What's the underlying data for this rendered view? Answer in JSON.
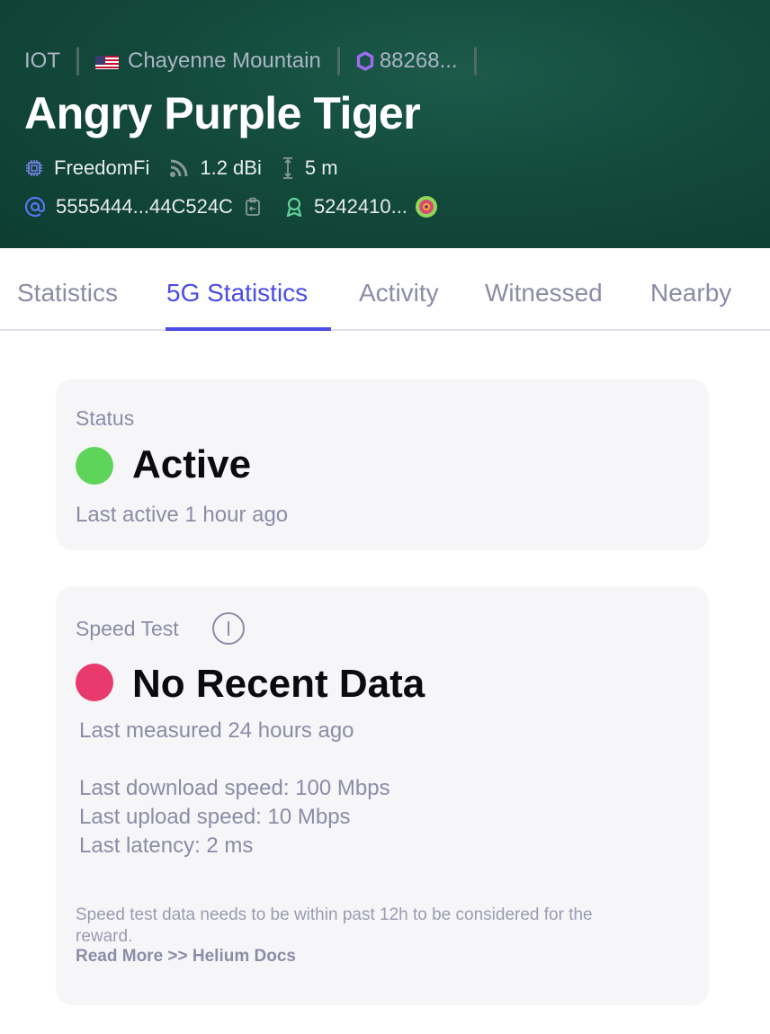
{
  "header": {
    "network": "IOT",
    "location": "Chayenne Mountain",
    "hex_id": "88268...",
    "title": "Angry Purple Tiger",
    "maker": "FreedomFi",
    "antenna_gain": "1.2 dBi",
    "elevation": "5 m",
    "address": "5555444...44C524C",
    "owner": "5242410..."
  },
  "icons": {
    "flag": "us-flag-icon",
    "hex": "hexagon-icon",
    "chip": "chip-icon",
    "signal": "signal-icon",
    "elevation": "elevation-icon",
    "address": "at-icon",
    "copy": "copy-icon",
    "owner": "user-badge-icon",
    "avatar": "avatar-icon",
    "info": "info-icon"
  },
  "tabs": [
    "Statistics",
    "5G Statistics",
    "Activity",
    "Witnessed",
    "Nearby"
  ],
  "active_tab": "5G Statistics",
  "status_card": {
    "label": "Status",
    "value": "Active",
    "detail": "Last active 1 hour ago",
    "color": "#5fd45a"
  },
  "speed_card": {
    "label": "Speed Test",
    "value": "No Recent Data",
    "measured": "Last measured 24 hours ago",
    "download": "Last download speed: 100 Mbps",
    "upload": "Last upload speed: 10 Mbps",
    "latency": "Last latency: 2 ms",
    "note": "Speed test data needs to be within past 12h to be considered for the reward.",
    "link": "Read More >> Helium Docs",
    "color": "#e83a6c"
  },
  "colors": {
    "header_bg": "#134a3c",
    "accent": "#4a4de6",
    "muted": "#8b8ca6"
  }
}
